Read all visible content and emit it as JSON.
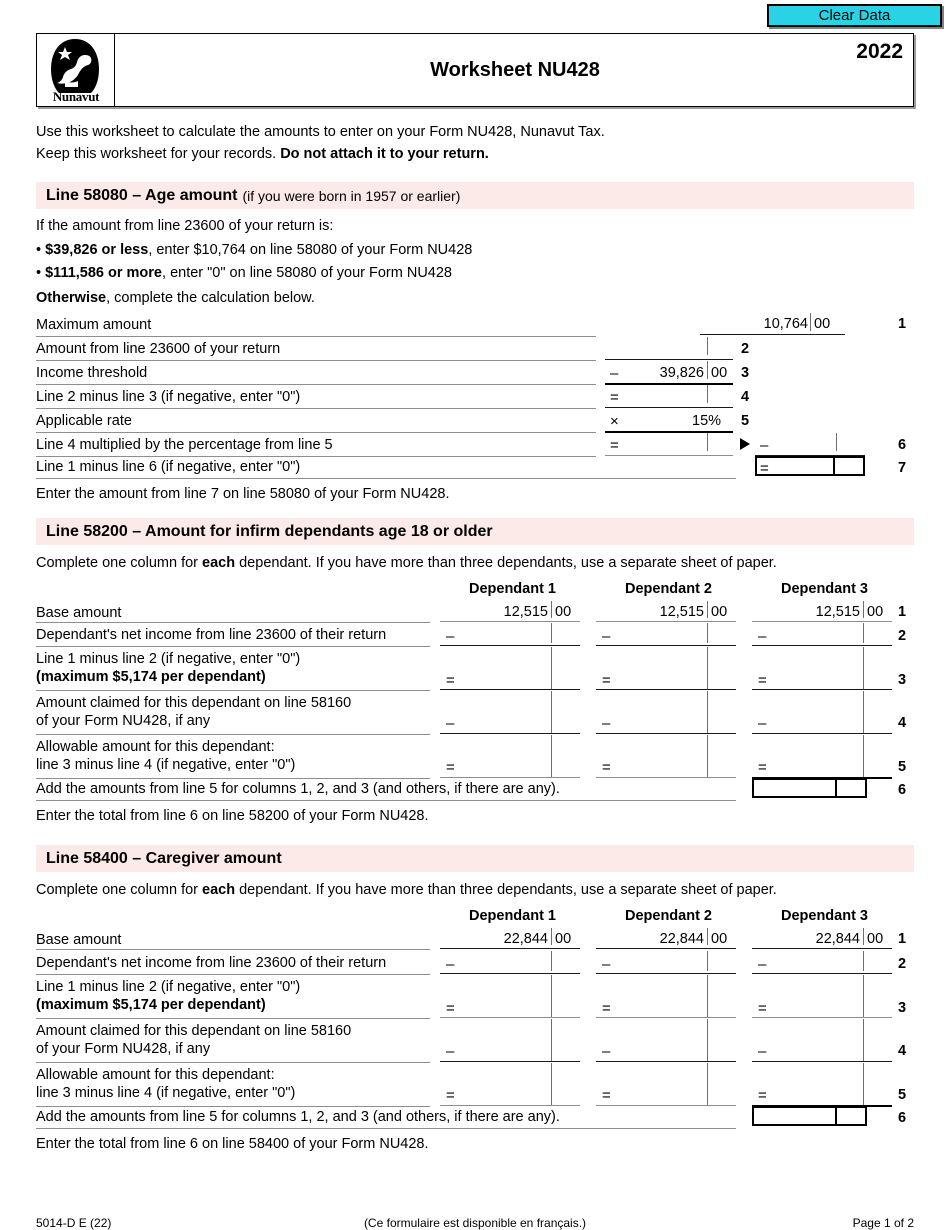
{
  "toolbar": {
    "clear_data_label": "Clear Data",
    "button_color": "#2ad2e6"
  },
  "header": {
    "logo_name": "Nunavut",
    "title": "Worksheet NU428",
    "year": "2022"
  },
  "intro": {
    "line1": "Use this worksheet to calculate the amounts to enter on your Form NU428, Nunavut Tax.",
    "line2_normal": "Keep this worksheet for your records. ",
    "line2_bold": "Do not attach it to your return."
  },
  "section_58080": {
    "band_strong": "Line 58080 – Age amount",
    "band_light": "(if you were born in 1957 or earlier)",
    "lead": "If the amount from line 23600 of your return is:",
    "bullet1_bold": "$39,826 or less",
    "bullet1_rest": ", enter $10,764 on line 58080 of your Form NU428",
    "bullet2_bold": "$111,586 or more",
    "bullet2_rest": ", enter \"0\" on line 58080 of your Form NU428",
    "otherwise_bold": "Otherwise",
    "otherwise_rest": ", complete the calculation below.",
    "rows": [
      {
        "n": "1",
        "label": "Maximum amount",
        "op": "",
        "amount": "10,764",
        "cents": "00"
      },
      {
        "n": "2",
        "label": "Amount from line 23600 of your return",
        "op": "",
        "amount": "",
        "cents": ""
      },
      {
        "n": "3",
        "label": "Income threshold",
        "op": "–",
        "amount": "39,826",
        "cents": "00"
      },
      {
        "n": "4",
        "label": "Line 2 minus line 3 (if negative, enter \"0\")",
        "op": "=",
        "amount": "",
        "cents": ""
      },
      {
        "n": "5",
        "label": "Applicable rate",
        "op": "×",
        "amount": "15%",
        "cents": ""
      },
      {
        "n": "6",
        "label": "Line 4 multiplied by the percentage from line 5",
        "op": "=",
        "amount": "",
        "cents": ""
      },
      {
        "n": "7",
        "label": "Line 1 minus line 6 (if negative, enter \"0\")",
        "op": "",
        "amount": "",
        "cents": ""
      }
    ],
    "row6_right_op": "–",
    "row7_right_op": "=",
    "closing": "Enter the amount from line 7 on line 58080 of your Form NU428."
  },
  "section_58200": {
    "band_strong": "Line 58200 – Amount for infirm dependants age 18 or older",
    "instruction_a": "Complete one column for ",
    "instruction_bold": "each",
    "instruction_b": " dependant. If you have more than three dependants, use a separate sheet of paper.",
    "columns": [
      "Dependant 1",
      "Dependant 2",
      "Dependant 3"
    ],
    "rows": [
      {
        "n": "1",
        "label_l1": "Base amount",
        "label_l2": "",
        "op": "",
        "amount": "12,515",
        "cents": "00"
      },
      {
        "n": "2",
        "label_l1": "Dependant's net income from line 23600 of their return",
        "label_l2": "",
        "op": "–",
        "amount": "",
        "cents": ""
      },
      {
        "n": "3",
        "label_l1": "Line 1 minus line 2 (if negative, enter \"0\")",
        "label_l2": "(maximum $5,174 per dependant)",
        "op": "=",
        "amount": "",
        "cents": ""
      },
      {
        "n": "4",
        "label_l1": "Amount claimed for this dependant on line 58160",
        "label_l2": "of your Form NU428, if any",
        "op": "–",
        "amount": "",
        "cents": ""
      },
      {
        "n": "5",
        "label_l1": "Allowable amount for this dependant:",
        "label_l2": "line 3 minus line 4 (if negative, enter \"0\")",
        "op": "=",
        "amount": "",
        "cents": ""
      }
    ],
    "total_row": {
      "n": "6",
      "label": "Add the amounts from line 5 for columns 1, 2, and 3 (and others, if there are any)."
    },
    "closing": "Enter the total from line 6 on line 58200 of your Form NU428."
  },
  "section_58400": {
    "band_strong": "Line 58400 – Caregiver amount",
    "instruction_a": "Complete one column for ",
    "instruction_bold": "each",
    "instruction_b": " dependant. If you have more than three dependants, use a separate sheet of paper.",
    "columns": [
      "Dependant 1",
      "Dependant 2",
      "Dependant 3"
    ],
    "rows": [
      {
        "n": "1",
        "label_l1": "Base amount",
        "label_l2": "",
        "op": "",
        "amount": "22,844",
        "cents": "00"
      },
      {
        "n": "2",
        "label_l1": "Dependant's net income from line 23600 of their return",
        "label_l2": "",
        "op": "–",
        "amount": "",
        "cents": ""
      },
      {
        "n": "3",
        "label_l1": "Line 1 minus line 2 (if negative, enter \"0\")",
        "label_l2": "(maximum $5,174 per dependant)",
        "op": "=",
        "amount": "",
        "cents": ""
      },
      {
        "n": "4",
        "label_l1": "Amount claimed for this dependant on line 58160",
        "label_l2": "of your Form NU428, if any",
        "op": "–",
        "amount": "",
        "cents": ""
      },
      {
        "n": "5",
        "label_l1": "Allowable amount for this dependant:",
        "label_l2": "line 3 minus line 4 (if negative, enter \"0\")",
        "op": "=",
        "amount": "",
        "cents": ""
      }
    ],
    "total_row": {
      "n": "6",
      "label": "Add the amounts from line 5 for columns 1, 2, and 3 (and others, if there are any)."
    },
    "closing": "Enter the total from line 6 on line 58400 of your Form NU428."
  },
  "footer": {
    "form_code": "5014-D E (22)",
    "french_note": "(Ce formulaire est disponible en français.)",
    "page": "Page 1 of 2"
  }
}
